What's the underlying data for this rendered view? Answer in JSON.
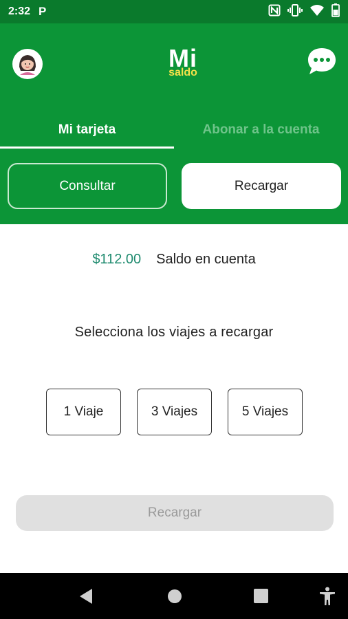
{
  "status_bar": {
    "time": "2:32",
    "app_notification": "P"
  },
  "header": {
    "logo_top": "Mi",
    "logo_bottom": "saldo"
  },
  "tabs": [
    {
      "label": "Mi tarjeta",
      "active": true
    },
    {
      "label": "Abonar a la cuenta",
      "active": false
    }
  ],
  "actions": {
    "consultar_label": "Consultar",
    "recargar_label": "Recargar"
  },
  "balance": {
    "amount": "$112.00",
    "label": "Saldo en cuenta"
  },
  "trip_selection": {
    "title": "Selecciona los viajes a recargar",
    "options": [
      "1 Viaje",
      "3 Viajes",
      "5 Viajes"
    ]
  },
  "main_action": {
    "label": "Recargar",
    "enabled": false
  },
  "colors": {
    "header_green": "#0c9537",
    "status_green": "#0a7a2c",
    "balance_teal": "#1f8b6f",
    "disabled_gray": "#e0e0e0",
    "logo_yellow": "#f4e14a"
  },
  "icons": {
    "status": [
      "nfc-icon",
      "vibrate-icon",
      "wifi-icon",
      "battery-icon"
    ],
    "nav": [
      "back-icon",
      "home-icon",
      "recents-icon",
      "accessibility-icon"
    ]
  }
}
